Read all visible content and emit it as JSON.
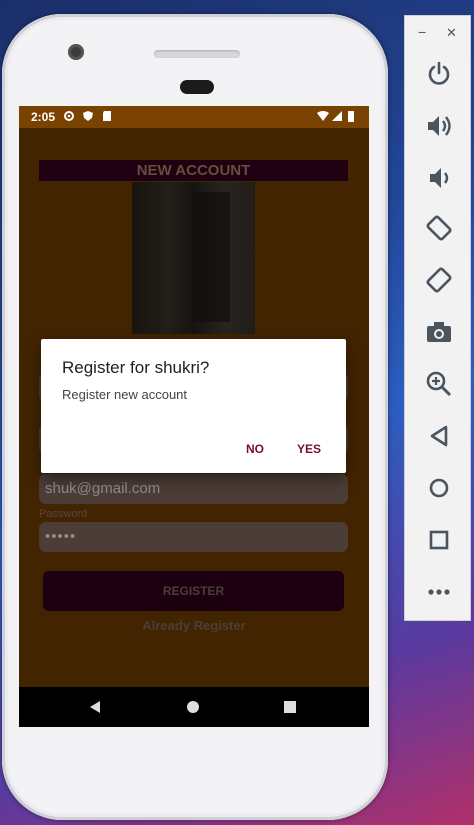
{
  "status_bar": {
    "time": "2:05"
  },
  "screen": {
    "title": "NEW ACCOUNT",
    "email_value": "shuk@gmail.com",
    "password_label": "Password",
    "password_value": "•••••",
    "register_button": "REGISTER",
    "already_link": "Already Register"
  },
  "dialog": {
    "title": "Register for shukri?",
    "message": "Register new account",
    "no_label": "NO",
    "yes_label": "YES"
  },
  "emulator_toolbar": {
    "minimize": "−",
    "close": "✕",
    "buttons": [
      "power-icon",
      "volume-up-icon",
      "volume-down-icon",
      "rotate-left-icon",
      "rotate-right-icon",
      "camera-icon",
      "zoom-icon",
      "back-icon",
      "home-icon",
      "overview-icon",
      "more-icon"
    ]
  },
  "colors": {
    "screen_background": "#7a4200",
    "title_background": "#3a0020",
    "dialog_button": "#7a0f2e",
    "toolbar_icon": "#4a5560"
  }
}
